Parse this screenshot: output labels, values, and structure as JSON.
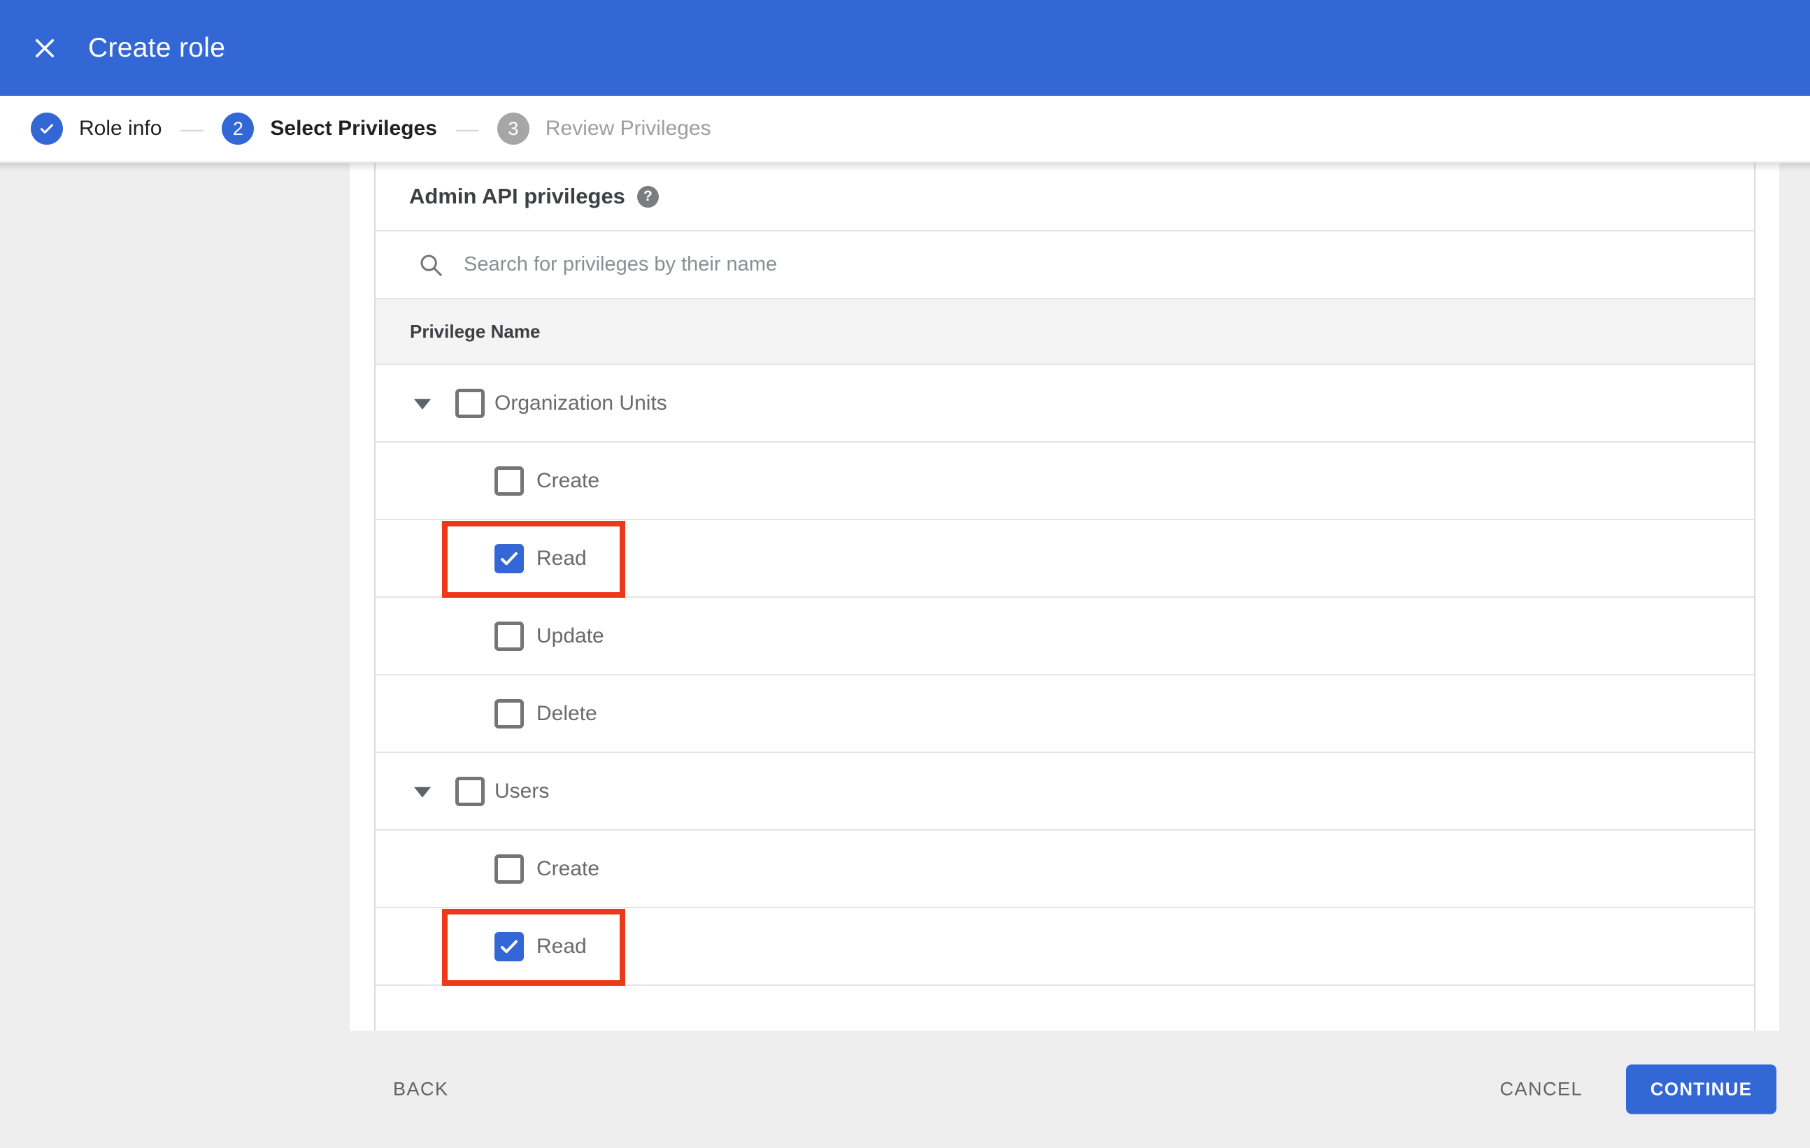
{
  "header": {
    "title": "Create role"
  },
  "stepper": {
    "connector": "—",
    "steps": [
      {
        "label": "Role info",
        "status": "complete"
      },
      {
        "label": "Select Privileges",
        "status": "active",
        "number": "2"
      },
      {
        "label": "Review Privileges",
        "status": "upcoming",
        "number": "3"
      }
    ]
  },
  "content": {
    "heading": "Admin API privileges",
    "help_glyph": "?",
    "search": {
      "placeholder": "Search for privileges by their name",
      "value": ""
    },
    "table": {
      "column_header": "Privilege Name",
      "rows": [
        {
          "label": "Organization Units",
          "type": "group",
          "checked": false,
          "expanded": true,
          "highlighted": false
        },
        {
          "label": "Create",
          "type": "child",
          "checked": false,
          "highlighted": false
        },
        {
          "label": "Read",
          "type": "child",
          "checked": true,
          "highlighted": true
        },
        {
          "label": "Update",
          "type": "child",
          "checked": false,
          "highlighted": false
        },
        {
          "label": "Delete",
          "type": "child",
          "checked": false,
          "highlighted": false
        },
        {
          "label": "Users",
          "type": "group",
          "checked": false,
          "expanded": true,
          "highlighted": false
        },
        {
          "label": "Create",
          "type": "child",
          "checked": false,
          "highlighted": false
        },
        {
          "label": "Read",
          "type": "child",
          "checked": true,
          "highlighted": true
        }
      ]
    }
  },
  "footer": {
    "back_label": "BACK",
    "cancel_label": "CANCEL",
    "continue_label": "CONTINUE"
  },
  "colors": {
    "primary_blue": "#3367d6",
    "highlight_red": "#ea3a17",
    "page_background": "#eeeeee"
  }
}
